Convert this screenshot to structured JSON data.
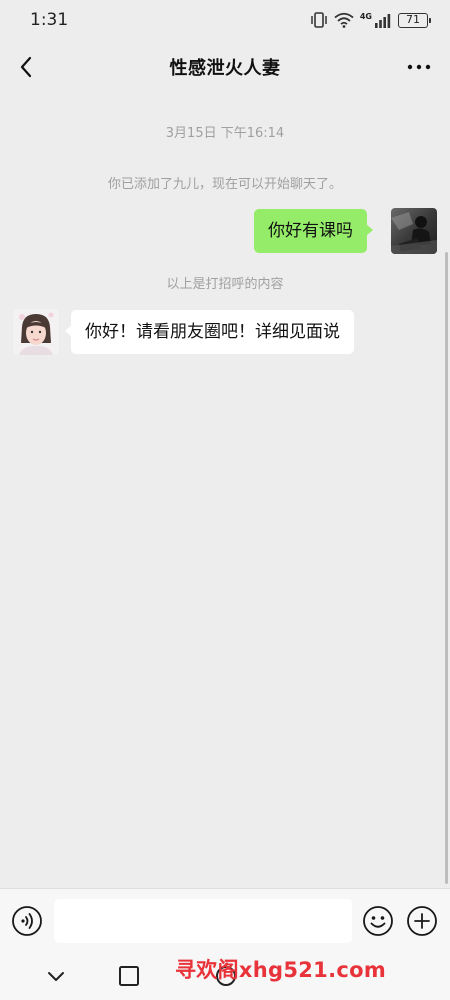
{
  "status_bar": {
    "time": "1:31",
    "network": "4G",
    "battery": "71"
  },
  "nav": {
    "title": "性感泄火人妻",
    "back_icon": "chevron-left-icon",
    "more_icon": "more-horizontal-icon"
  },
  "messages": {
    "timestamp": "3月15日 下午16:14",
    "system_added": "你已添加了九儿，现在可以开始聊天了。",
    "outgoing_text": "你好有课吗",
    "greeting_notice": "以上是打招呼的内容",
    "incoming_text": "你好！请看朋友圈吧！详细见面说"
  },
  "input_bar": {
    "value": "",
    "voice_icon": "voice-icon",
    "emoji_icon": "emoji-icon",
    "plus_icon": "plus-circle-icon"
  },
  "watermark": "寻欢阁xhg521.com",
  "colors": {
    "background": "#ededed",
    "outgoing_bubble": "#95ec69",
    "incoming_bubble": "#ffffff",
    "system_text": "#a0a0a0",
    "watermark": "#e8333a"
  }
}
